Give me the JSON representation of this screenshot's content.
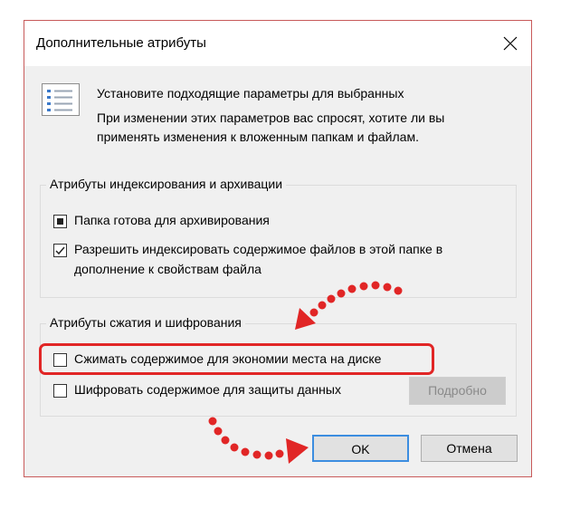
{
  "window": {
    "title": "Дополнительные атрибуты",
    "close_icon": "close-icon"
  },
  "header": {
    "icon": "attributes-list-icon",
    "line1": "Установите подходящие параметры для выбранных",
    "line2": "При изменении этих параметров вас спросят, хотите ли вы",
    "line3": "применять изменения к вложенным папкам и файлам."
  },
  "indexing_group": {
    "legend": "Атрибуты индексирования и архивации",
    "archive": {
      "label": "Папка готова для архивирования",
      "state": "indeterminate"
    },
    "index": {
      "label_line1": "Разрешить индексировать содержимое файлов в этой папке в",
      "label_line2": "дополнение к свойствам файла",
      "state": "checked"
    }
  },
  "compression_group": {
    "legend": "Атрибуты сжатия и шифрования",
    "compress": {
      "label": "Сжимать содержимое для экономии места на диске",
      "state": "unchecked"
    },
    "encrypt": {
      "label": "Шифровать содержимое для защиты данных",
      "state": "unchecked"
    },
    "details_label": "Подробно"
  },
  "buttons": {
    "ok_label": "OK",
    "cancel_label": "Отмена"
  },
  "colors": {
    "annotation_red": "#e12626",
    "focus_blue": "#3c8de0",
    "dialog_bg": "#f0f0f0"
  }
}
